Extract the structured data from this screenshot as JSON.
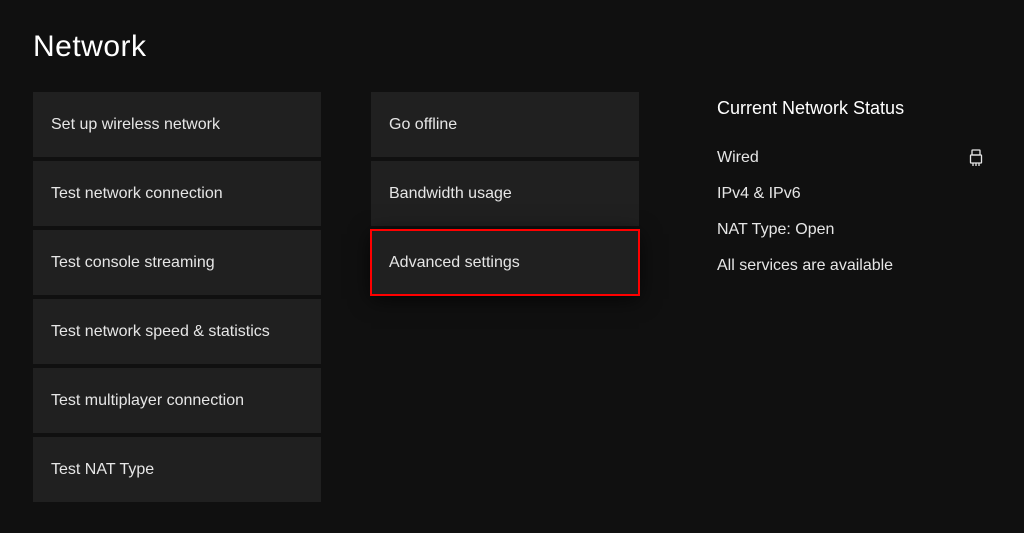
{
  "title": "Network",
  "columns": {
    "left": [
      {
        "id": "setup-wireless",
        "label": "Set up wireless network"
      },
      {
        "id": "test-connection",
        "label": "Test network connection"
      },
      {
        "id": "test-streaming",
        "label": "Test console streaming"
      },
      {
        "id": "test-speed",
        "label": "Test network speed & statistics"
      },
      {
        "id": "test-multiplayer",
        "label": "Test multiplayer connection"
      },
      {
        "id": "test-nat",
        "label": "Test NAT Type"
      }
    ],
    "mid": [
      {
        "id": "go-offline",
        "label": "Go offline"
      },
      {
        "id": "bandwidth-usage",
        "label": "Bandwidth usage"
      },
      {
        "id": "advanced-settings",
        "label": "Advanced settings",
        "highlighted": true
      }
    ]
  },
  "status": {
    "heading": "Current Network Status",
    "connection_type": "Wired",
    "ip_version": "IPv4 & IPv6",
    "nat_type": "NAT Type: Open",
    "services": "All services are available"
  },
  "highlight_color": "#ff0000",
  "icon": {
    "connection": "ethernet-icon"
  }
}
